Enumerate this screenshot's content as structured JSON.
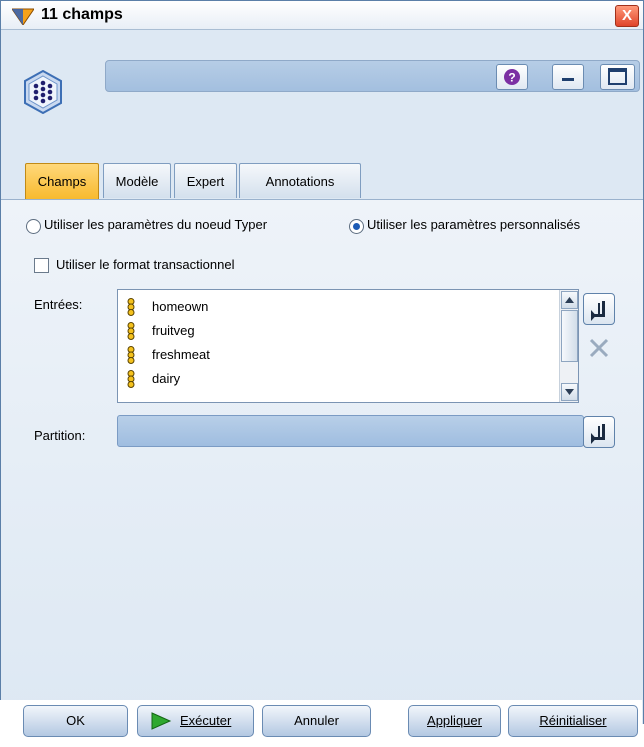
{
  "window": {
    "title": "11 champs",
    "close_label": "X"
  },
  "header": {
    "node_name_value": ""
  },
  "tabs": [
    {
      "label": "Champs",
      "active": true
    },
    {
      "label": "Modèle",
      "active": false
    },
    {
      "label": "Expert",
      "active": false
    },
    {
      "label": "Annotations",
      "active": false
    }
  ],
  "options": {
    "radio_type_node": "Utiliser les paramètres du noeud Typer",
    "radio_custom": "Utiliser les paramètres personnalisés",
    "radio_selected": "custom",
    "checkbox_transactional": "Utiliser le format transactionnel",
    "checkbox_checked": false
  },
  "inputs": {
    "label": "Entrées:",
    "fields": [
      "homeown",
      "fruitveg",
      "freshmeat",
      "dairy"
    ]
  },
  "partition": {
    "label": "Partition:",
    "value": ""
  },
  "footer": {
    "ok": "OK",
    "run": "Exécuter",
    "cancel": "Annuler",
    "apply": "Appliquer",
    "reset": "Réinitialiser"
  },
  "colors": {
    "accent_tab": "#f8b92c",
    "field_bg": "#a3bfdf",
    "window_bg": "#dde8f3"
  }
}
